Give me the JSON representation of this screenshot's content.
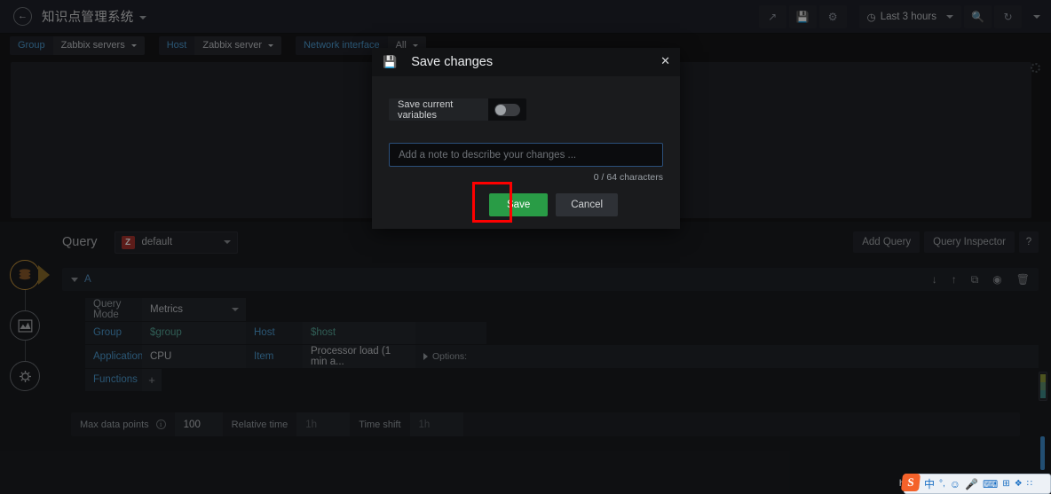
{
  "topnav": {
    "back_icon": "arrow-left-icon",
    "dashboard_title": "知识点管理系统",
    "actions": [
      {
        "name": "share-dashboard",
        "icon": "share-icon",
        "glyph": "↪"
      },
      {
        "name": "save-dashboard",
        "icon": "save-icon",
        "glyph": "💾"
      },
      {
        "name": "dashboard-settings",
        "icon": "gear-icon",
        "glyph": "⚙"
      }
    ],
    "time_range": {
      "label": "Last 3 hours",
      "clock_icon": "clock-icon"
    },
    "zoom_out_icon": "search-minus-icon",
    "refresh_icon": "refresh-icon",
    "refresh_caret_icon": "chevron-down-icon"
  },
  "variables": [
    {
      "label": "Group",
      "value": "Zabbix servers"
    },
    {
      "label": "Host",
      "value": "Zabbix server"
    },
    {
      "label": "Network interface",
      "value": "All"
    }
  ],
  "modal": {
    "icon": "save-floppy-icon",
    "title": "Save changes",
    "close_icon": "close-icon",
    "toggle": {
      "label": "Save current variables",
      "state": "off"
    },
    "note": {
      "value": "",
      "placeholder": "Add a note to describe your changes ..."
    },
    "char_count": "0 / 64 characters",
    "save_label": "Save",
    "cancel_label": "Cancel",
    "highlight_color": "#fe0000",
    "save_color": "#299c46"
  },
  "rail": [
    {
      "name": "query-step",
      "icon": "database-icon",
      "active": true
    },
    {
      "name": "visualization-step",
      "icon": "chart-area-icon",
      "active": false
    },
    {
      "name": "panel-settings-step",
      "icon": "gear-wrench-icon",
      "active": false
    }
  ],
  "query": {
    "header_label": "Query",
    "datasource": {
      "badge": "Z",
      "name": "default",
      "badge_color": "#a8342f"
    },
    "add_query_label": "Add Query",
    "query_inspector_label": "Query Inspector",
    "help_label": "?",
    "row": {
      "letter": "A",
      "actions": [
        {
          "name": "move-query-down",
          "icon": "arrow-down-icon",
          "glyph": "↓"
        },
        {
          "name": "move-query-up",
          "icon": "arrow-up-icon",
          "glyph": "↑"
        },
        {
          "name": "duplicate-query",
          "icon": "copy-icon",
          "glyph": "⧉"
        },
        {
          "name": "toggle-query-visibility",
          "icon": "eye-icon",
          "glyph": "◉"
        },
        {
          "name": "remove-query",
          "icon": "trash-icon",
          "glyph": "Ὕ1"
        }
      ]
    },
    "fields": {
      "query_mode_label": "Query Mode",
      "query_mode_value": "Metrics",
      "group_label": "Group",
      "group_value": "$group",
      "host_label": "Host",
      "host_value": "$host",
      "application_label": "Application",
      "application_value": "CPU",
      "item_label": "Item",
      "item_value": "Processor load (1 min a...",
      "options_label": "Options:",
      "functions_label": "Functions",
      "functions_add": "+"
    },
    "options": {
      "max_data_points_label": "Max data points",
      "max_data_points_value": "100",
      "relative_time_label": "Relative time",
      "relative_time_placeholder": "1h",
      "time_shift_label": "Time shift",
      "time_shift_placeholder": "1h"
    }
  },
  "ime": {
    "logo": "S",
    "items": [
      {
        "name": "ime-mode-chinese",
        "glyph": "中"
      },
      {
        "name": "ime-punctuation",
        "glyph": "°,"
      },
      {
        "name": "ime-emoji",
        "glyph": "☺"
      },
      {
        "name": "ime-voice",
        "glyph": "⬤"
      },
      {
        "name": "ime-keyboard",
        "glyph": "⌨"
      },
      {
        "name": "ime-toolbox",
        "glyph": "⊞"
      },
      {
        "name": "ime-skin",
        "glyph": "❖"
      },
      {
        "name": "ime-menu",
        "glyph": "∷"
      }
    ]
  }
}
